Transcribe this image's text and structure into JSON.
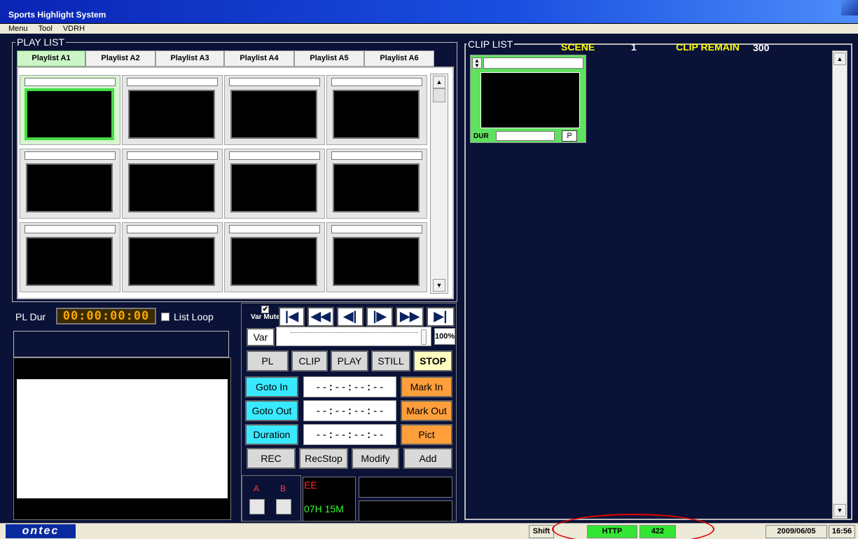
{
  "window": {
    "title": "Sports Highlight System"
  },
  "menu": [
    "Menu",
    "Tool",
    "VDRH"
  ],
  "playlist": {
    "group_label": "PLAY LIST",
    "tabs": [
      "Playlist A1",
      "Playlist A2",
      "Playlist A3",
      "Playlist A4",
      "Playlist A5",
      "Playlist A6"
    ],
    "active_tab": "Playlist A1",
    "pl_dur_label": "PL Dur",
    "pl_dur_value": "00:00:00:00",
    "list_loop_label": "List Loop"
  },
  "transport": {
    "var_mute_label": "Var Mute",
    "var_mute_checked": true,
    "buttons": [
      "go-to-start",
      "fast-rewind",
      "step-back",
      "step-forward",
      "fast-forward",
      "go-to-end"
    ],
    "var_label": "Var",
    "speed_percent": "100%",
    "speed_fraction": 1.0
  },
  "controls": {
    "mode_buttons": [
      "PL",
      "CLIP",
      "PLAY",
      "STILL",
      "STOP"
    ],
    "goto_in": "Goto In",
    "goto_out": "Goto Out",
    "duration": "Duration",
    "mark_in": "Mark In",
    "mark_out": "Mark Out",
    "pict": "Pict",
    "in_tc": "--:--:--:--",
    "out_tc": "--:--:--:--",
    "dur_tc": "--:--:--:--",
    "rec": "REC",
    "recstop": "RecStop",
    "modify": "Modify",
    "add": "Add",
    "a_label": "A",
    "b_label": "B",
    "ee_label": "EE",
    "remaining": "07H 15M"
  },
  "cliplist": {
    "label": "CLIP LIST",
    "scene_label": "SCENE",
    "scene_value": "1",
    "remain_label": "CLIP REMAIN",
    "remain_value": "300",
    "card": {
      "dur_label": "DUR",
      "p_label": "P"
    }
  },
  "statusbar": {
    "logo": "ontec",
    "shift": "Shift",
    "http": "HTTP",
    "port": "422",
    "date": "2009/06/05",
    "time": "16:56"
  },
  "colors": {
    "background": "#0a1238",
    "accent_cyan": "#39e9ff",
    "accent_orange": "#ff9f3c",
    "selected_green": "#44dd44",
    "clip_label_yellow": "#ffff00",
    "highlight_red": "#e00000"
  }
}
